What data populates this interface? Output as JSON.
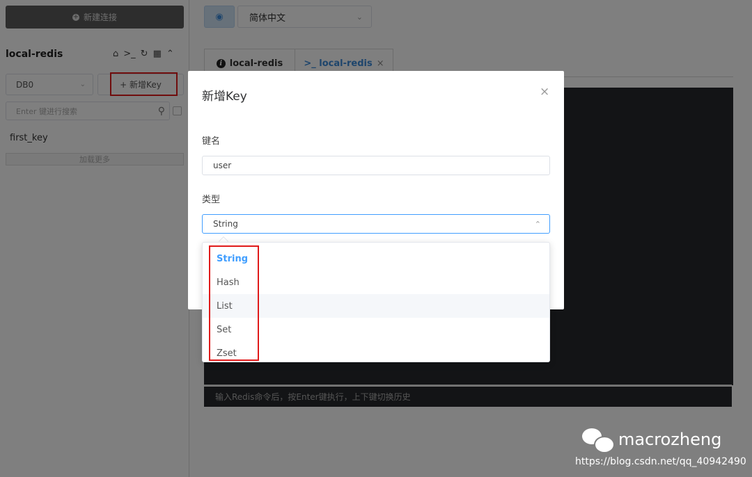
{
  "sidebar": {
    "new_connection_label": "新建连接",
    "connection_name": "local-redis",
    "db_selected": "DB0",
    "add_key_label": "+ 新增Key",
    "search_placeholder": "Enter 键进行搜索",
    "keys": [
      "first_key"
    ],
    "load_more_label": "加载更多"
  },
  "toolbar": {
    "language_selected": "简体中文"
  },
  "tabs": [
    {
      "label": "local-redis",
      "icon": "info-icon"
    },
    {
      "label": ">_ local-redis",
      "icon": "terminal-icon",
      "closable": true
    }
  ],
  "console": {
    "input_placeholder": "输入Redis命令后，按Enter键执行，上下键切换历史"
  },
  "dialog": {
    "title": "新增Key",
    "close_glyph": "×",
    "name_label": "键名",
    "name_value": "user",
    "type_label": "类型",
    "type_value": "String",
    "options": [
      "String",
      "Hash",
      "List",
      "Set",
      "Zset"
    ],
    "selected_option": "String",
    "hovered_option": "List"
  },
  "watermark": {
    "name": "macrozheng",
    "url": "https://blog.csdn.net/qq_40942490"
  },
  "colors": {
    "accent": "#409eff",
    "highlight_box": "#e01a1a",
    "console_bg": "#26292c"
  }
}
